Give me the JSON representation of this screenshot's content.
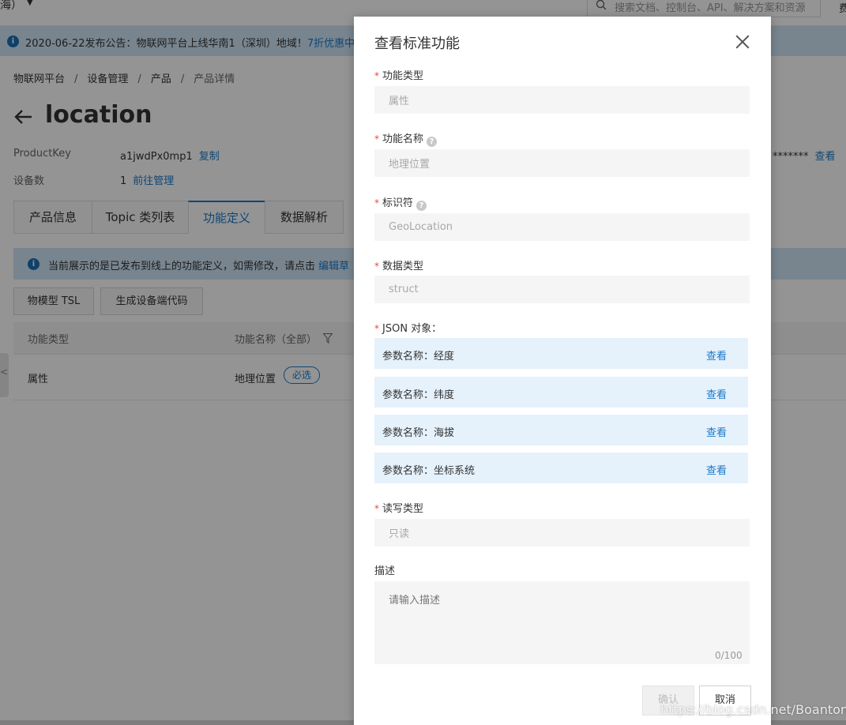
{
  "topbar": {
    "region": "海）",
    "search_placeholder": "搜索文档、控制台、API、解决方案和资源",
    "extra": "费"
  },
  "announcement": {
    "text": "2020-06-22发布公告：物联网平台上线华南1（深圳）地域！",
    "link": "7折优惠中"
  },
  "breadcrumb": [
    "物联网平台",
    "设备管理",
    "产品",
    "产品详情"
  ],
  "page": {
    "title": "location",
    "product_key_label": "ProductKey",
    "product_key_value": "a1jwdPx0mp1",
    "copy_link": "复制",
    "device_count_label": "设备数",
    "device_count_value": "1",
    "manage_link": "前往管理",
    "masked_secret": "*******",
    "view_link": "查看"
  },
  "tabs": [
    "产品信息",
    "Topic 类列表",
    "功能定义",
    "数据解析"
  ],
  "info_bar": {
    "text": "当前展示的是已发布到线上的功能定义，如需修改，请点击",
    "link": "编辑草"
  },
  "buttons": {
    "tsl": "物模型 TSL",
    "gen_code": "生成设备端代码"
  },
  "table": {
    "headers": [
      "功能类型",
      "功能名称（全部）"
    ],
    "rows": [
      {
        "type": "属性",
        "name": "地理位置",
        "badge": "必选"
      }
    ]
  },
  "modal": {
    "title": "查看标准功能",
    "fields": {
      "func_type": {
        "label": "功能类型",
        "value": "属性"
      },
      "func_name": {
        "label": "功能名称",
        "value": "地理位置"
      },
      "identifier": {
        "label": "标识符",
        "value": "GeoLocation"
      },
      "data_type": {
        "label": "数据类型",
        "value": "struct"
      },
      "json_label": "JSON 对象：",
      "json_params": [
        {
          "label": "参数名称：经度",
          "action": "查看"
        },
        {
          "label": "参数名称：纬度",
          "action": "查看"
        },
        {
          "label": "参数名称：海拔",
          "action": "查看"
        },
        {
          "label": "参数名称：坐标系统",
          "action": "查看"
        }
      ],
      "rw_type": {
        "label": "读写类型",
        "value": "只读"
      },
      "desc": {
        "label": "描述",
        "placeholder": "请输入描述",
        "counter": "0/100"
      }
    },
    "ok": "确认",
    "cancel": "取消",
    "help_glyph": "?",
    "required_glyph": "*"
  },
  "watermark": "https://blog.csdn.net/Boantong_",
  "colors": {
    "accent": "#1b79c9",
    "required": "#e74c3c",
    "info_bg": "#cfe6f7",
    "json_row_bg": "#e5f1fb"
  }
}
